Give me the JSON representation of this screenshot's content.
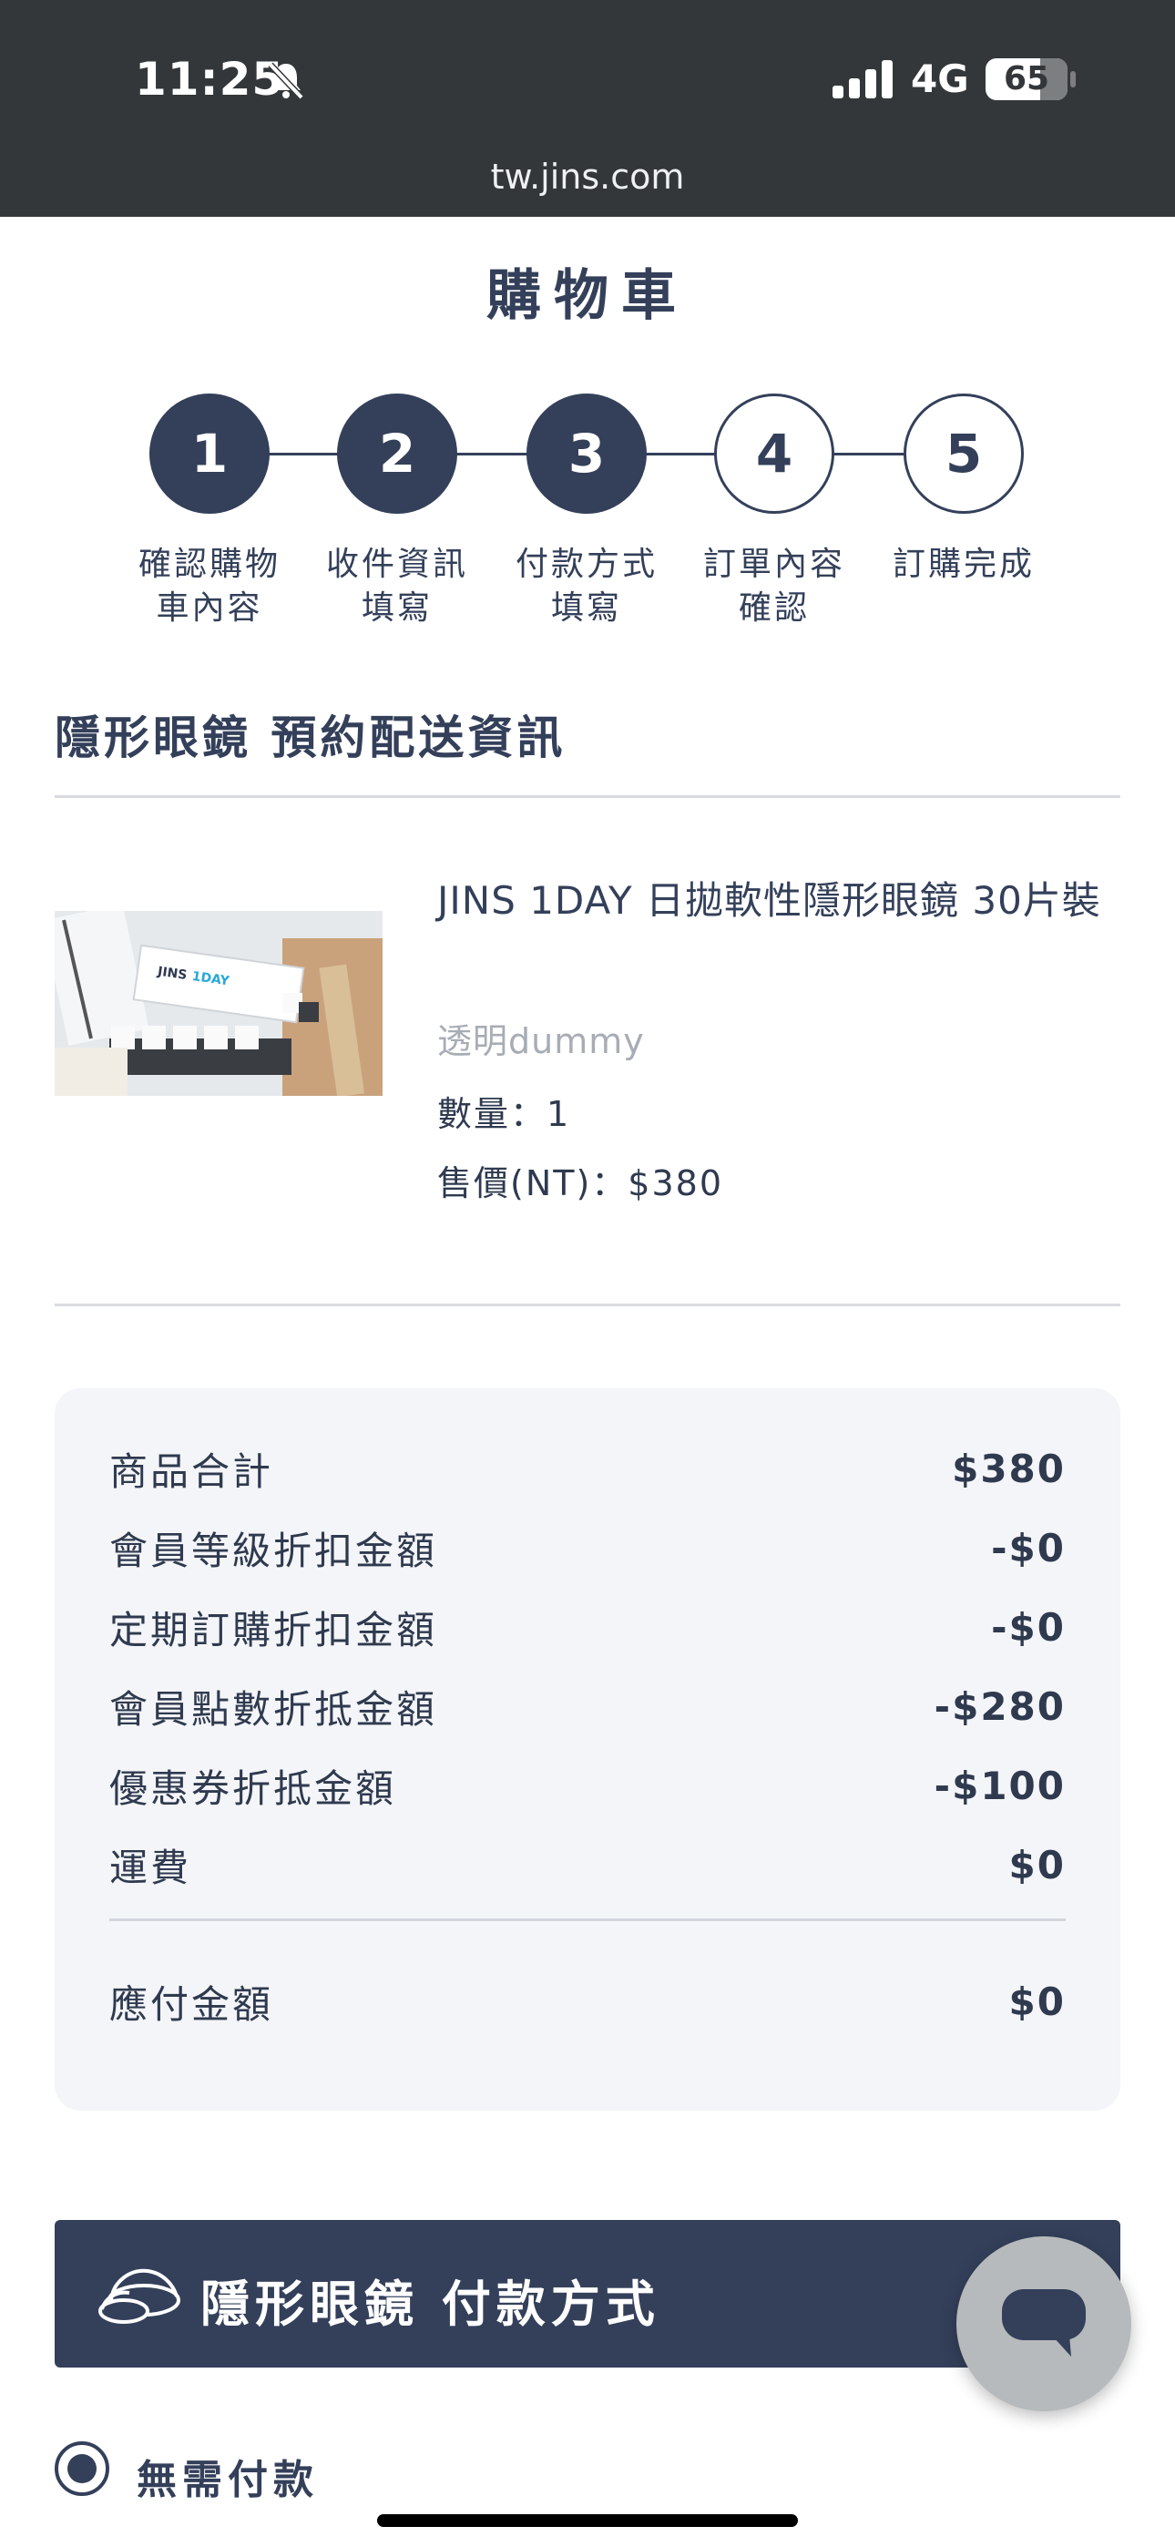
{
  "status_bar": {
    "time": "11:25",
    "network": "4G",
    "battery": "65"
  },
  "browser": {
    "url": "tw.jins.com"
  },
  "page": {
    "title": "購物車"
  },
  "steps": [
    {
      "number": "1",
      "label_line1": "確認購物",
      "label_line2": "車內容",
      "state": "done"
    },
    {
      "number": "2",
      "label_line1": "收件資訊",
      "label_line2": "填寫",
      "state": "done"
    },
    {
      "number": "3",
      "label_line1": "付款方式",
      "label_line2": "填寫",
      "state": "done"
    },
    {
      "number": "4",
      "label_line1": "訂單內容",
      "label_line2": "確認",
      "state": "todo"
    },
    {
      "number": "5",
      "label_line1": "訂購完成",
      "label_line2": "",
      "state": "todo"
    }
  ],
  "delivery_section": {
    "heading": "隱形眼鏡 預約配送資訊"
  },
  "product": {
    "image_logo": "JINS 1DAY",
    "name": "JINS 1DAY 日拋軟性隱形眼鏡 30片裝",
    "color": "透明dummy",
    "quantity": "數量：1",
    "price": "售價(NT)：$380"
  },
  "summary": {
    "rows": [
      {
        "label": "商品合計",
        "value": "$380"
      },
      {
        "label": "會員等級折扣金額",
        "value": "-$0"
      },
      {
        "label": "定期訂購折扣金額",
        "value": "-$0"
      },
      {
        "label": "會員點數折抵金額",
        "value": "-$280"
      },
      {
        "label": "優惠券折抵金額",
        "value": "-$100"
      },
      {
        "label": "運費",
        "value": "$0"
      }
    ],
    "total_label": "應付金額",
    "total_value": "$0"
  },
  "payment": {
    "heading": "隱形眼鏡 付款方式",
    "icon": "contact-lens-icon",
    "option_label": "無需付款",
    "option_selected": true
  },
  "chat": {
    "icon": "chat-bubble-icon"
  },
  "colors": {
    "primary": "#34405a",
    "topbar": "#34373a",
    "summary_bg": "#f4f5f8",
    "accent_logo": "#28a8d8"
  }
}
